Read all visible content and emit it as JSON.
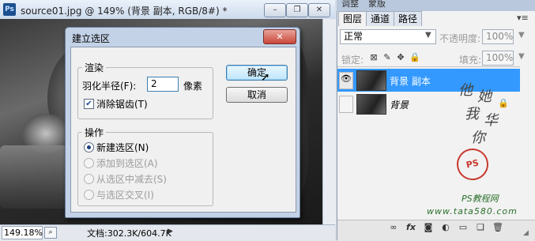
{
  "document": {
    "title": "source01.jpg @ 149% (背景 副本, RGB/8#) *",
    "app_icon": "Ps",
    "zoom": "149.18%",
    "doc_info": "文档:302.3K/604.7K",
    "window_buttons": [
      "–",
      "❐",
      "✕"
    ]
  },
  "dialog": {
    "title": "建立选区",
    "close": "✕",
    "render_group": {
      "label": "渲染",
      "feather_label": "羽化半径(F):",
      "feather_value": "2",
      "feather_unit": "像素",
      "antialias_label": "消除锯齿(T)",
      "antialias_checked": true
    },
    "operation_group": {
      "label": "操作",
      "options": [
        {
          "label": "新建选区(N)",
          "selected": true,
          "enabled": true
        },
        {
          "label": "添加到选区(A)",
          "selected": false,
          "enabled": false
        },
        {
          "label": "从选区中减去(S)",
          "selected": false,
          "enabled": false
        },
        {
          "label": "与选区交叉(I)",
          "selected": false,
          "enabled": false
        }
      ]
    },
    "ok_label": "确定",
    "cancel_label": "取消"
  },
  "panel": {
    "top_tabs": [
      "调整",
      "蒙版"
    ],
    "tabs": [
      "图层",
      "通道",
      "路径"
    ],
    "blend_mode": "正常",
    "opacity_label": "不透明度:",
    "opacity_value": "100%",
    "lock_label": "锁定:",
    "fill_label": "填充:",
    "fill_value": "100%",
    "layers": [
      {
        "name": "背景 副本",
        "selected": true,
        "visible": true
      },
      {
        "name": "背景",
        "selected": false,
        "visible": false,
        "locked": true
      }
    ],
    "bottom_icons": [
      "link-icon",
      "fx-icon",
      "mask-icon",
      "adjustment-icon",
      "folder-icon",
      "new-layer-icon",
      "trash-icon"
    ]
  },
  "watermark": {
    "vertical_text": [
      "他",
      "她",
      "我",
      "华",
      "你"
    ],
    "seal": "PS",
    "site_name": "PS教程网",
    "url": "www.tata580.com"
  },
  "colors": {
    "selected_layer": "#3399ff",
    "dialog_frame": "#c3d2e6"
  }
}
